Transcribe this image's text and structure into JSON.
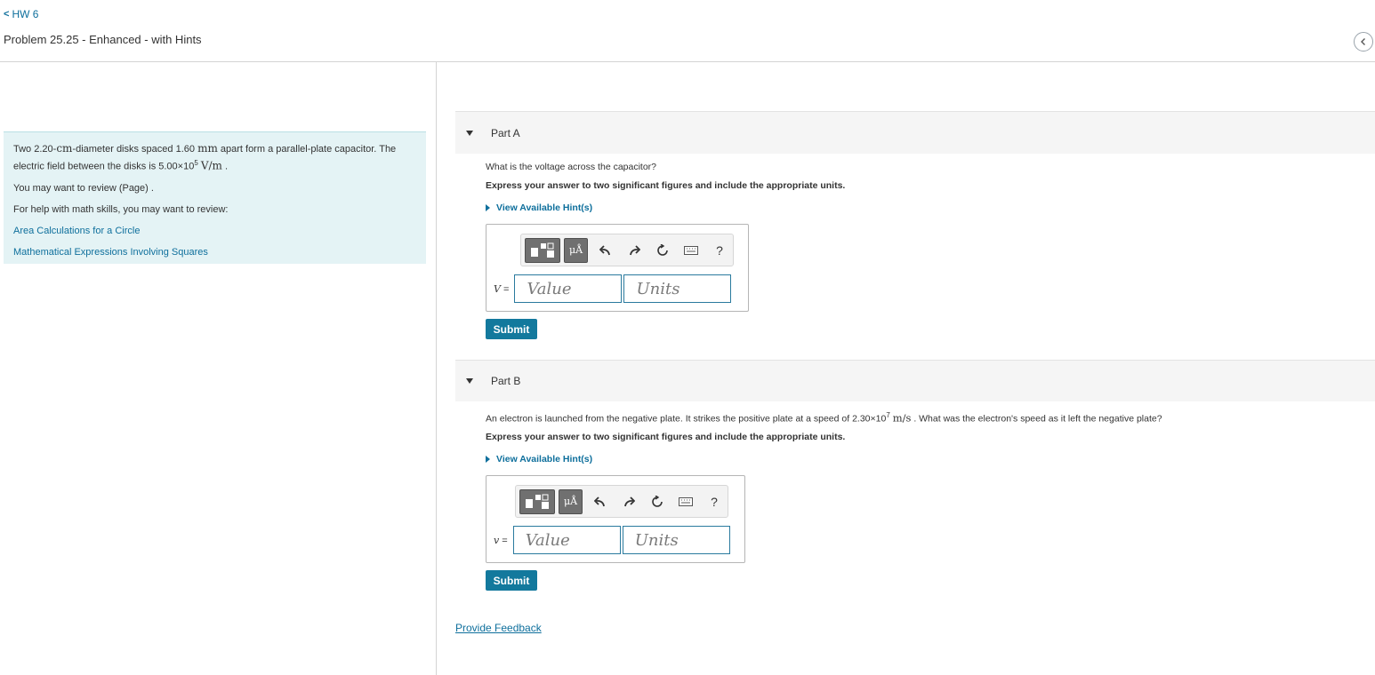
{
  "nav": {
    "back_chevron": "<",
    "back_label": "HW 6"
  },
  "problem": {
    "title": "Problem 25.25 - Enhanced - with Hints"
  },
  "collapse_icon": "chevron-left-icon",
  "intro": {
    "text_1": "Two 2.20-",
    "unit_cm": "cm",
    "text_2": "-diameter disks spaced 1.60 ",
    "unit_mm": "mm",
    "text_3": " apart form a parallel-plate capacitor. The electric field between the disks is 5.00×10",
    "exp": "5",
    "text_4": " ",
    "unit_field": "V/m",
    "text_5": " .",
    "review_text": "You may want to review (Page) .",
    "help_text": "For help with math skills, you may want to review:",
    "link_1": "Area Calculations for a Circle",
    "link_2": "Mathematical Expressions Involving Squares"
  },
  "part_a": {
    "title": "Part A",
    "question": "What is the voltage across the capacitor?",
    "instruction": "Express your answer to two significant figures and include the appropriate units.",
    "hint_label": "View Available Hint(s)",
    "var_label": "V",
    "equals": " =",
    "value_placeholder": "Value",
    "units_placeholder": "Units",
    "submit": "Submit",
    "units_btn": "μÅ",
    "help_btn": "?"
  },
  "part_b": {
    "title": "Part B",
    "q_text_1": "An electron is launched from the negative plate. It strikes the positive plate at a speed of 2.30×10",
    "q_exp": "7",
    "q_unit": "m/s",
    "q_text_2": ". What was the electron's speed as it left the negative plate?",
    "instruction": "Express your answer to two significant figures and include the appropriate units.",
    "hint_label": "View Available Hint(s)",
    "var_label": "v",
    "equals": " =",
    "value_placeholder": "Value",
    "units_placeholder": "Units",
    "submit": "Submit",
    "units_btn": "μÅ",
    "help_btn": "?"
  },
  "feedback": {
    "label": "Provide Feedback"
  },
  "colors": {
    "accent": "#13799d",
    "link": "#0e6f9c",
    "intro_bg": "#e4f3f5",
    "part_bg": "#f5f5f5"
  }
}
